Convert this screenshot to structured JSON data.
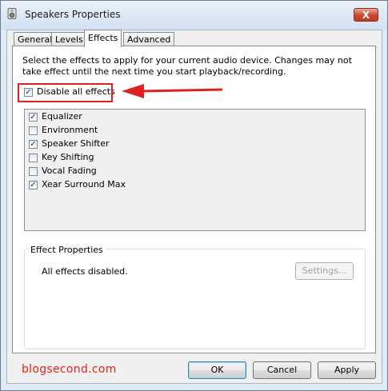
{
  "window": {
    "title": "Speakers Properties",
    "close_label": "X"
  },
  "tabs": [
    {
      "label": "General"
    },
    {
      "label": "Levels"
    },
    {
      "label": "Effects"
    },
    {
      "label": "Advanced"
    }
  ],
  "effects": {
    "description": "Select the effects to apply for your current audio device. Changes may not take effect until the next time you start playback/recording.",
    "disable_all": {
      "label": "Disable all effects",
      "checked": true
    },
    "items": [
      {
        "label": "Equalizer",
        "checked": true
      },
      {
        "label": "Environment",
        "checked": false
      },
      {
        "label": "Speaker Shifter",
        "checked": true
      },
      {
        "label": "Key Shifting",
        "checked": false
      },
      {
        "label": "Vocal Fading",
        "checked": false
      },
      {
        "label": "Xear Surround Max",
        "checked": true
      }
    ],
    "properties": {
      "title": "Effect Properties",
      "status": "All effects disabled.",
      "settings_button": "Settings..."
    }
  },
  "buttons": {
    "ok": "OK",
    "cancel": "Cancel",
    "apply": "Apply"
  },
  "watermark": "blogsecond.com",
  "colors": {
    "annotation_red": "#e0201d",
    "watermark_red": "#e32417"
  }
}
